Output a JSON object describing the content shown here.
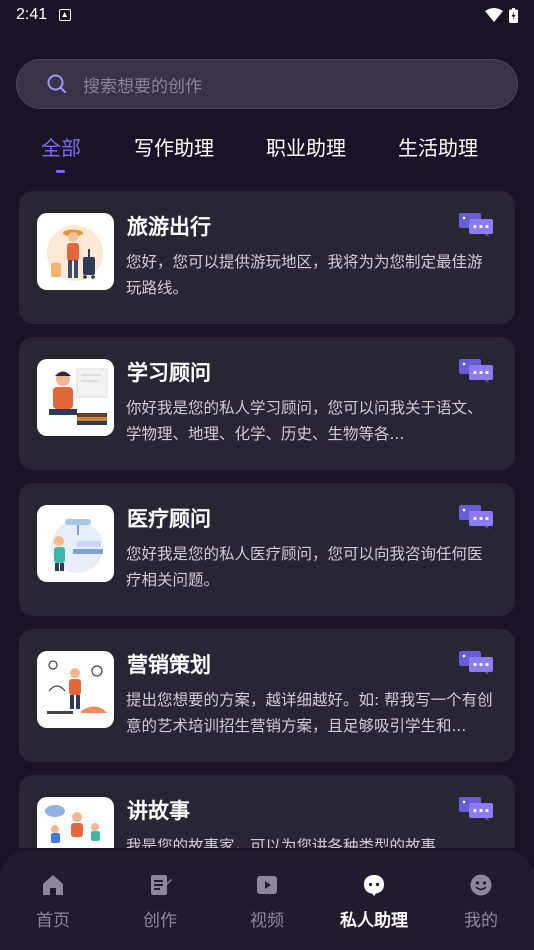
{
  "status": {
    "time": "2:41"
  },
  "search": {
    "placeholder": "搜索想要的创作"
  },
  "tabs": [
    {
      "label": "全部",
      "active": true
    },
    {
      "label": "写作助理",
      "active": false
    },
    {
      "label": "职业助理",
      "active": false
    },
    {
      "label": "生活助理",
      "active": false
    }
  ],
  "cards": [
    {
      "title": "旅游出行",
      "desc": "您好，您可以提供游玩地区，我将为为您制定最佳游玩路线。",
      "thumb": "traveler-illustration"
    },
    {
      "title": "学习顾问",
      "desc": "你好我是您的私人学习顾问，您可以问我关于语文、学物理、地理、化学、历史、生物等各...",
      "thumb": "student-illustration"
    },
    {
      "title": "医疗顾问",
      "desc": "您好我是您的私人医疗顾问，您可以向我咨询任何医疗相关问题。",
      "thumb": "doctor-illustration"
    },
    {
      "title": "营销策划",
      "desc": "提出您想要的方案，越详细越好。如: 帮我写一个有创意的艺术培训招生营销方案，且足够吸引学生和...",
      "thumb": "marketing-illustration"
    },
    {
      "title": "讲故事",
      "desc": "我是您的故事家，可以为您讲各种类型的故事",
      "thumb": "storyteller-illustration"
    }
  ],
  "nav": [
    {
      "label": "首页",
      "icon": "home-icon",
      "active": false
    },
    {
      "label": "创作",
      "icon": "edit-icon",
      "active": false
    },
    {
      "label": "视频",
      "icon": "video-icon",
      "active": false
    },
    {
      "label": "私人助理",
      "icon": "assistant-chat-icon",
      "active": true
    },
    {
      "label": "我的",
      "icon": "profile-icon",
      "active": false
    }
  ],
  "colors": {
    "background": "#1a1225",
    "card": "#2a2533",
    "accent": "#7b6ef0",
    "chat_icon": "#8b7cf0"
  }
}
